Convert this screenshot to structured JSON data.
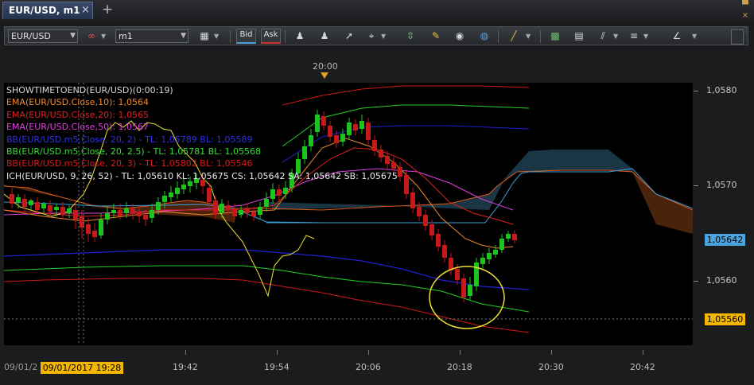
{
  "tab": {
    "title": "EUR/USD, m1",
    "close": "×",
    "add": "+"
  },
  "window_controls": [
    "▀",
    "×"
  ],
  "toolbar": {
    "symbol": "EUR/USD",
    "timeframe": "m1",
    "bid_label": "Bid",
    "ask_label": "Ask"
  },
  "time_top": "20:00",
  "legend": [
    {
      "text": "SHOWTIMETOEND(EUR/USD)(0:00:19)",
      "color": "#d9d9d9"
    },
    {
      "text": "EMA(EUR/USD.Close,10): 1,0564",
      "color": "#f08a2c"
    },
    {
      "text": "EMA(EUR/USD.Close,20): 1,0565",
      "color": "#e02020"
    },
    {
      "text": "EMA(EUR/USD.Close,50): 1,0567",
      "color": "#e040e0"
    },
    {
      "text": "BB(EUR/USD.m5.Close, 20, 2) -  TL: 1,05789  BL: 1,05589",
      "color": "#3030e8"
    },
    {
      "text": "BB(EUR/USD.m5.Close, 20, 2.5) -  TL: 1,05781  BL: 1,05568",
      "color": "#30e030"
    },
    {
      "text": "BB(EUR/USD.m5.Close, 20, 3) -  TL: 1,05802  BL: 1,05546",
      "color": "#e01818"
    },
    {
      "text": "ICH(EUR/USD, 9, 26, 52) -  TL: 1,05610  KL: 1,05675  CS: 1,05642  SA: 1,05642  SB: 1,05675",
      "color": "#e8e8e8"
    }
  ],
  "price_axis": {
    "labels": [
      "1,0580",
      "1,0570",
      "1,0560"
    ],
    "current_price": "1,05642",
    "cursor_price": "1,05560",
    "current_color": "#4aa3df",
    "cursor_color": "#f2b500"
  },
  "time_axis": {
    "labels": [
      "19:42",
      "19:54",
      "20:06",
      "20:18",
      "20:30",
      "20:42"
    ],
    "cursor_date_left": "09/01/2",
    "cursor_badge": "09/01/2017 19:28"
  }
}
